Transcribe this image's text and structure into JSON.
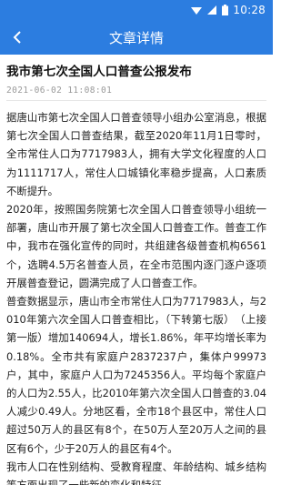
{
  "status_bar": {
    "time": "10:28"
  },
  "app_bar": {
    "title": "文章详情"
  },
  "article": {
    "title": "我市第七次全国人口普查公报发布",
    "date": "2021-06-02 11:08:01",
    "paragraphs": [
      "据唐山市第七次全国人口普查领导小组办公室消息，根据第七次全国人口普查结果，截至2020年11月1日零时，全市常住人口为7717983人，拥有大学文化程度的人口为1111717人，常住人口城镇化率稳步提高，人口素质不断提升。",
      "2020年，按照国务院第七次全国人口普查领导小组统一部署，唐山市开展了第七次全国人口普查工作。普查工作中，我市在强化宣传的同时，共组建各级普查机构6561个，选聘4.5万名普查人员，在全市范围内逐门逐户逐项开展普查登记，圆满完成了人口普查工作。",
      "普查数据显示，唐山市全市常住人口为7717983人，与2010年第六次全国人口普查相比，（下转第七版）　（上接第一版）增加140694人，增长1.86%，年平均增长率为0.18%。全市共有家庭户2837237户，集体户99973户，其中，家庭户人口为7245356人。平均每个家庭户的人口为2.55人，比2010年第六次全国人口普查的3.04人减少0.49人。分地区看，全市18个县区中，常住人口超过50万人的县区有8个，在50万人至20万人之间的县区有6个，少于20万人的县区有4个。",
      "我市人口在性别结构、受教育程度、年龄结构、城乡结构等方面出现了一些新的变化和特征。"
    ]
  }
}
